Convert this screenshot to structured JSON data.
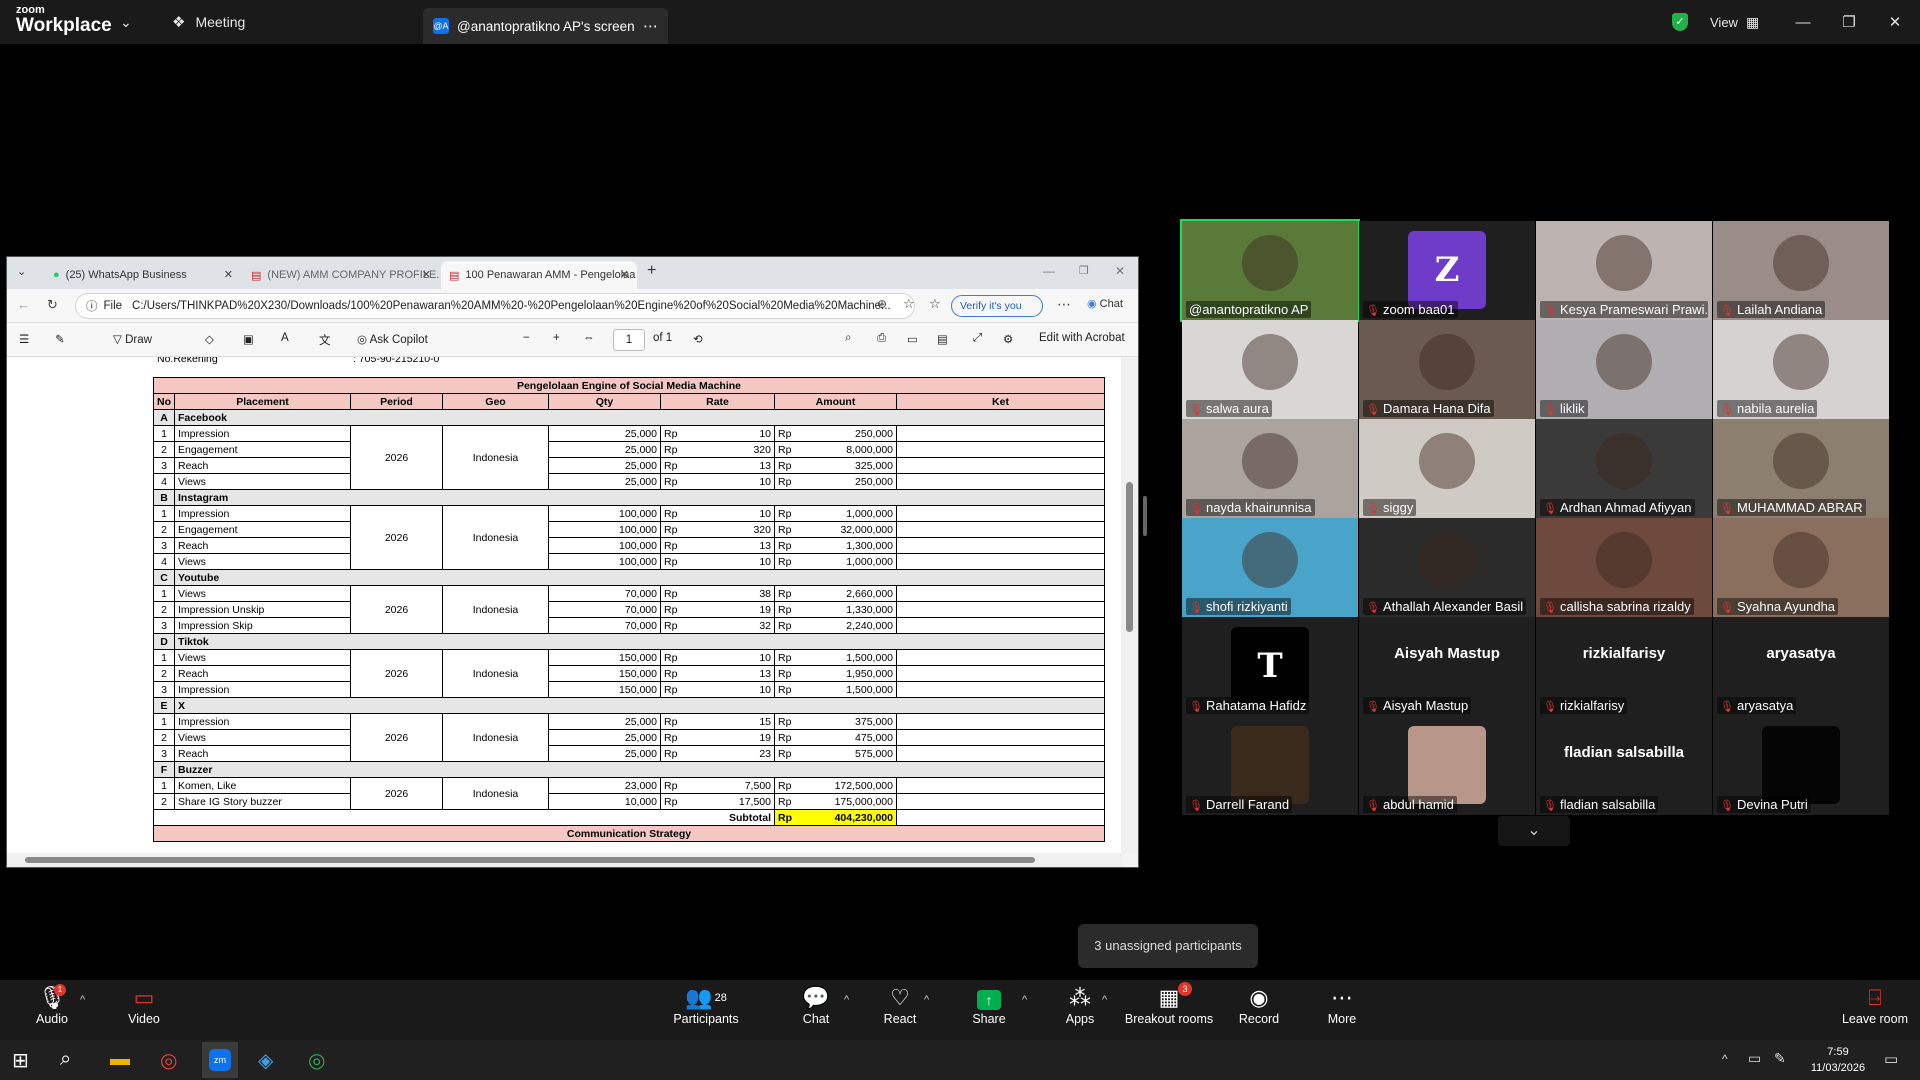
{
  "app": {
    "logo_top": "zoom",
    "logo_bottom": "Workplace",
    "meeting_label": "Meeting",
    "screen_tab_label": "@anantopratikno AP's screen",
    "view_label": "View"
  },
  "browser": {
    "tabs": [
      {
        "label": "(25) WhatsApp Business"
      },
      {
        "label": "(NEW) AMM COMPANY PROFILE.p"
      },
      {
        "label": "100 Penawaran AMM - Pengelolaa"
      }
    ],
    "address_prefix": "File",
    "url": "C:/Users/THINKPAD%20X230/Downloads/100%20Penawaran%20AMM%20-%20Pengelolaan%20Engine%20of%20Social%20Media%20Machine...",
    "verify_label": "Verify it's you",
    "chat_label": "Chat",
    "toolbar": {
      "draw": "Draw",
      "ask_copilot": "Ask Copilot",
      "page_current": "1",
      "page_total": "of 1",
      "edit_acrobat": "Edit with Acrobat"
    }
  },
  "document": {
    "top_line_label": "No.Rekening",
    "top_line_value": ": 705-90-215210-0",
    "table_title": "Pengelolaan Engine of Social Media Machine",
    "columns": [
      "No",
      "Placement",
      "Period",
      "Geo",
      "Qty",
      "Rate",
      "Amount",
      "Ket"
    ],
    "sections": [
      {
        "letter": "A",
        "name": "Facebook",
        "period": "2026",
        "geo": "Indonesia",
        "rows": [
          {
            "no": "1",
            "placement": "Impression",
            "qty": "25,000",
            "rate": "10",
            "amount": "250,000"
          },
          {
            "no": "2",
            "placement": "Engagement",
            "qty": "25,000",
            "rate": "320",
            "amount": "8,000,000"
          },
          {
            "no": "3",
            "placement": "Reach",
            "qty": "25,000",
            "rate": "13",
            "amount": "325,000"
          },
          {
            "no": "4",
            "placement": "Views",
            "qty": "25,000",
            "rate": "10",
            "amount": "250,000"
          }
        ]
      },
      {
        "letter": "B",
        "name": "Instagram",
        "period": "2026",
        "geo": "Indonesia",
        "rows": [
          {
            "no": "1",
            "placement": "Impression",
            "qty": "100,000",
            "rate": "10",
            "amount": "1,000,000"
          },
          {
            "no": "2",
            "placement": "Engagement",
            "qty": "100,000",
            "rate": "320",
            "amount": "32,000,000"
          },
          {
            "no": "3",
            "placement": "Reach",
            "qty": "100,000",
            "rate": "13",
            "amount": "1,300,000"
          },
          {
            "no": "4",
            "placement": "Views",
            "qty": "100,000",
            "rate": "10",
            "amount": "1,000,000"
          }
        ]
      },
      {
        "letter": "C",
        "name": "Youtube",
        "period": "2026",
        "geo": "Indonesia",
        "rows": [
          {
            "no": "1",
            "placement": "Views",
            "qty": "70,000",
            "rate": "38",
            "amount": "2,660,000"
          },
          {
            "no": "2",
            "placement": "Impression Unskip",
            "qty": "70,000",
            "rate": "19",
            "amount": "1,330,000"
          },
          {
            "no": "3",
            "placement": "Impression Skip",
            "qty": "70,000",
            "rate": "32",
            "amount": "2,240,000"
          }
        ]
      },
      {
        "letter": "D",
        "name": "Tiktok",
        "period": "2026",
        "geo": "Indonesia",
        "rows": [
          {
            "no": "1",
            "placement": "Views",
            "qty": "150,000",
            "rate": "10",
            "amount": "1,500,000"
          },
          {
            "no": "2",
            "placement": "Reach",
            "qty": "150,000",
            "rate": "13",
            "amount": "1,950,000"
          },
          {
            "no": "3",
            "placement": "Impression",
            "qty": "150,000",
            "rate": "10",
            "amount": "1,500,000"
          }
        ]
      },
      {
        "letter": "E",
        "name": "X",
        "period": "2026",
        "geo": "Indonesia",
        "rows": [
          {
            "no": "1",
            "placement": "Impression",
            "qty": "25,000",
            "rate": "15",
            "amount": "375,000"
          },
          {
            "no": "2",
            "placement": "Views",
            "qty": "25,000",
            "rate": "19",
            "amount": "475,000"
          },
          {
            "no": "3",
            "placement": "Reach",
            "qty": "25,000",
            "rate": "23",
            "amount": "575,000"
          }
        ]
      },
      {
        "letter": "F",
        "name": "Buzzer",
        "period": "2026",
        "geo": "Indonesia",
        "rows": [
          {
            "no": "1",
            "placement": "Komen, Like",
            "qty": "23,000",
            "rate": "7,500",
            "amount": "172,500,000"
          },
          {
            "no": "2",
            "placement": "Share IG Story buzzer",
            "qty": "10,000",
            "rate": "17,500",
            "amount": "175,000,000"
          }
        ]
      }
    ],
    "currency": "Rp",
    "subtotal_label": "Subtotal",
    "subtotal_value": "404,230,000",
    "next_section_title": "Communication Strategy"
  },
  "participants_gallery": [
    {
      "name": "@anantopratikno AP",
      "type": "video",
      "color": "#5a7a3a",
      "muted": false,
      "active": true
    },
    {
      "name": "zoom baa01",
      "type": "avatar",
      "initial": "Z",
      "color": "#6f3bc9",
      "muted": true
    },
    {
      "name": "Kesya Prameswari Prawi...",
      "type": "video",
      "color": "#bdb3b0",
      "muted": true
    },
    {
      "name": "Lailah Andiana",
      "type": "video",
      "color": "#9a8c87",
      "muted": true
    },
    {
      "name": "salwa aura",
      "type": "video",
      "color": "#d9d7d6",
      "muted": true
    },
    {
      "name": "Damara Hana Difa",
      "type": "video",
      "color": "#6b5a4f",
      "muted": true
    },
    {
      "name": "liklik",
      "type": "video",
      "color": "#b0aeb1",
      "muted": true
    },
    {
      "name": "nabila aurelia",
      "type": "video",
      "color": "#d6d2d1",
      "muted": true
    },
    {
      "name": "nayda khairunnisa",
      "type": "video",
      "color": "#aaa39e",
      "muted": true
    },
    {
      "name": "siggy",
      "type": "video",
      "color": "#cfcac4",
      "muted": true
    },
    {
      "name": "Ardhan Ahmad Afiyyan",
      "type": "video",
      "color": "#3a3a3a",
      "muted": true
    },
    {
      "name": "MUHAMMAD ABRAR",
      "type": "video",
      "color": "#8c7f70",
      "muted": true
    },
    {
      "name": "shofi rizkiyanti",
      "type": "video",
      "color": "#4aa3c9",
      "muted": true
    },
    {
      "name": "Athallah Alexander Basil",
      "type": "video",
      "color": "#2b2b2b",
      "muted": true
    },
    {
      "name": "callisha sabrina rizaldy",
      "type": "video",
      "color": "#6d4a3d",
      "muted": true
    },
    {
      "name": "Syahna Ayundha",
      "type": "video",
      "color": "#8a6f5e",
      "muted": true
    },
    {
      "name": "Rahatama Hafidz",
      "type": "avatar",
      "initial": "T",
      "color": "#000000",
      "muted": true
    },
    {
      "name": "Aisyah Mastup",
      "type": "name",
      "muted": true
    },
    {
      "name": "rizkialfarisy",
      "type": "name",
      "muted": true
    },
    {
      "name": "aryasatya",
      "type": "name",
      "muted": true
    },
    {
      "name": "Darrell Farand",
      "type": "avatar",
      "initial": "",
      "color": "#3a2a1c",
      "muted": true
    },
    {
      "name": "abdul hamid",
      "type": "avatar",
      "initial": "",
      "color": "#b8968a",
      "muted": true
    },
    {
      "name": "fladian salsabilla",
      "type": "name",
      "muted": true
    },
    {
      "name": "Devina Putri",
      "type": "avatar",
      "initial": "",
      "color": "#050505",
      "muted": true
    }
  ],
  "unassigned_tooltip": "3 unassigned participants",
  "toolbar": {
    "audio": "Audio",
    "video": "Video",
    "participants": "Participants",
    "participants_count": "28",
    "chat": "Chat",
    "react": "React",
    "share": "Share",
    "apps": "Apps",
    "breakout": "Breakout rooms",
    "breakout_badge": "3",
    "record": "Record",
    "more": "More",
    "leave": "Leave room",
    "audio_badge": "1"
  },
  "taskbar": {
    "time": "7:59",
    "date": "11/03/2026"
  },
  "colors": {
    "zoom_blue": "#0e72ed",
    "share_green": "#00b050",
    "muted_red": "#e0352b",
    "active_border": "#23d959",
    "table_header_pink": "#f4c7c3",
    "subtotal_yellow": "#ffff00"
  }
}
